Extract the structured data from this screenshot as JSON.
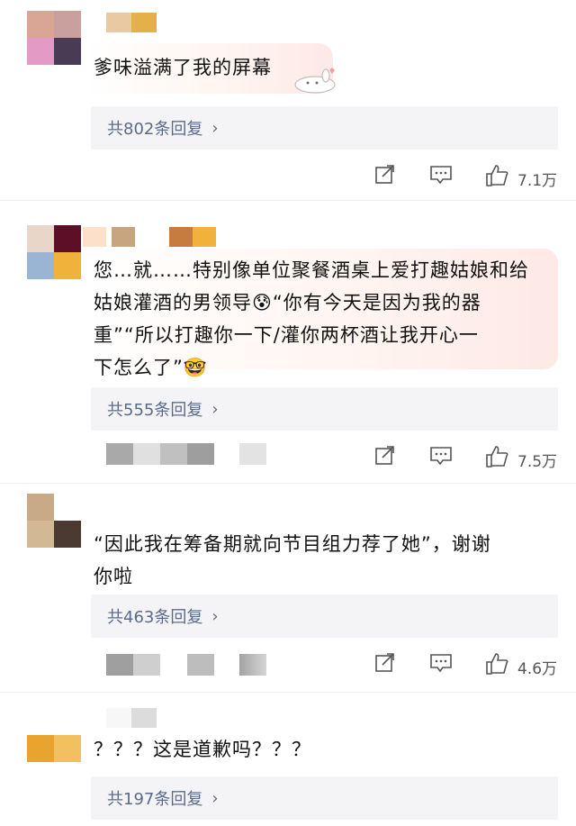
{
  "comments": [
    {
      "text": "爹味溢满了我的屏幕",
      "replies_label": "共802条回复",
      "likes": "7.1万",
      "avatar_colors": [
        "#d9a595",
        "#c9a09e",
        "#e39bc6",
        "#4a3b55"
      ],
      "name_colors": [
        "#e9c9a2",
        "#e3b049"
      ],
      "sticker": "bunny-sticker"
    },
    {
      "text": "您…就……特别像单位聚餐酒桌上爱打趣姑娘和给\n姑娘灌酒的男领导😰“你有今天是因为我的器\n重”“所以打趣你一下/灌你两杯酒让我开心一\n下怎么了”🤓",
      "replies_label": "共555条回复",
      "likes": "7.5万",
      "avatar_colors": [
        "#e8d6c9",
        "#5c0f26",
        "#9ab4d4",
        "#f0b23a"
      ],
      "name_colors": [
        "#fbe1c9",
        "#c6a57f",
        "#c67b3f",
        "#f0b23a"
      ]
    },
    {
      "text": "“因此我在筹备期就向节目组力荐了她”，谢谢\n你啦",
      "replies_label": "共463条回复",
      "likes": "4.6万",
      "avatar_colors": [
        "#c9aa87",
        "#ffffff",
        "#d3b894",
        "#4a3a31"
      ]
    },
    {
      "text": "？？？这是道歉吗？？？",
      "replies_label": "共197条回复",
      "avatar_colors": [
        "#ffffff",
        "#ffffff",
        "#e8a42c",
        "#f3c060"
      ]
    }
  ],
  "icons": {
    "share": "share-icon",
    "comment": "comment-icon",
    "like": "like-icon",
    "chevron": "›"
  },
  "colors": {
    "reply_link": "#5a6b8a",
    "reply_bg": "#f4f4f6",
    "icon": "#555555"
  }
}
